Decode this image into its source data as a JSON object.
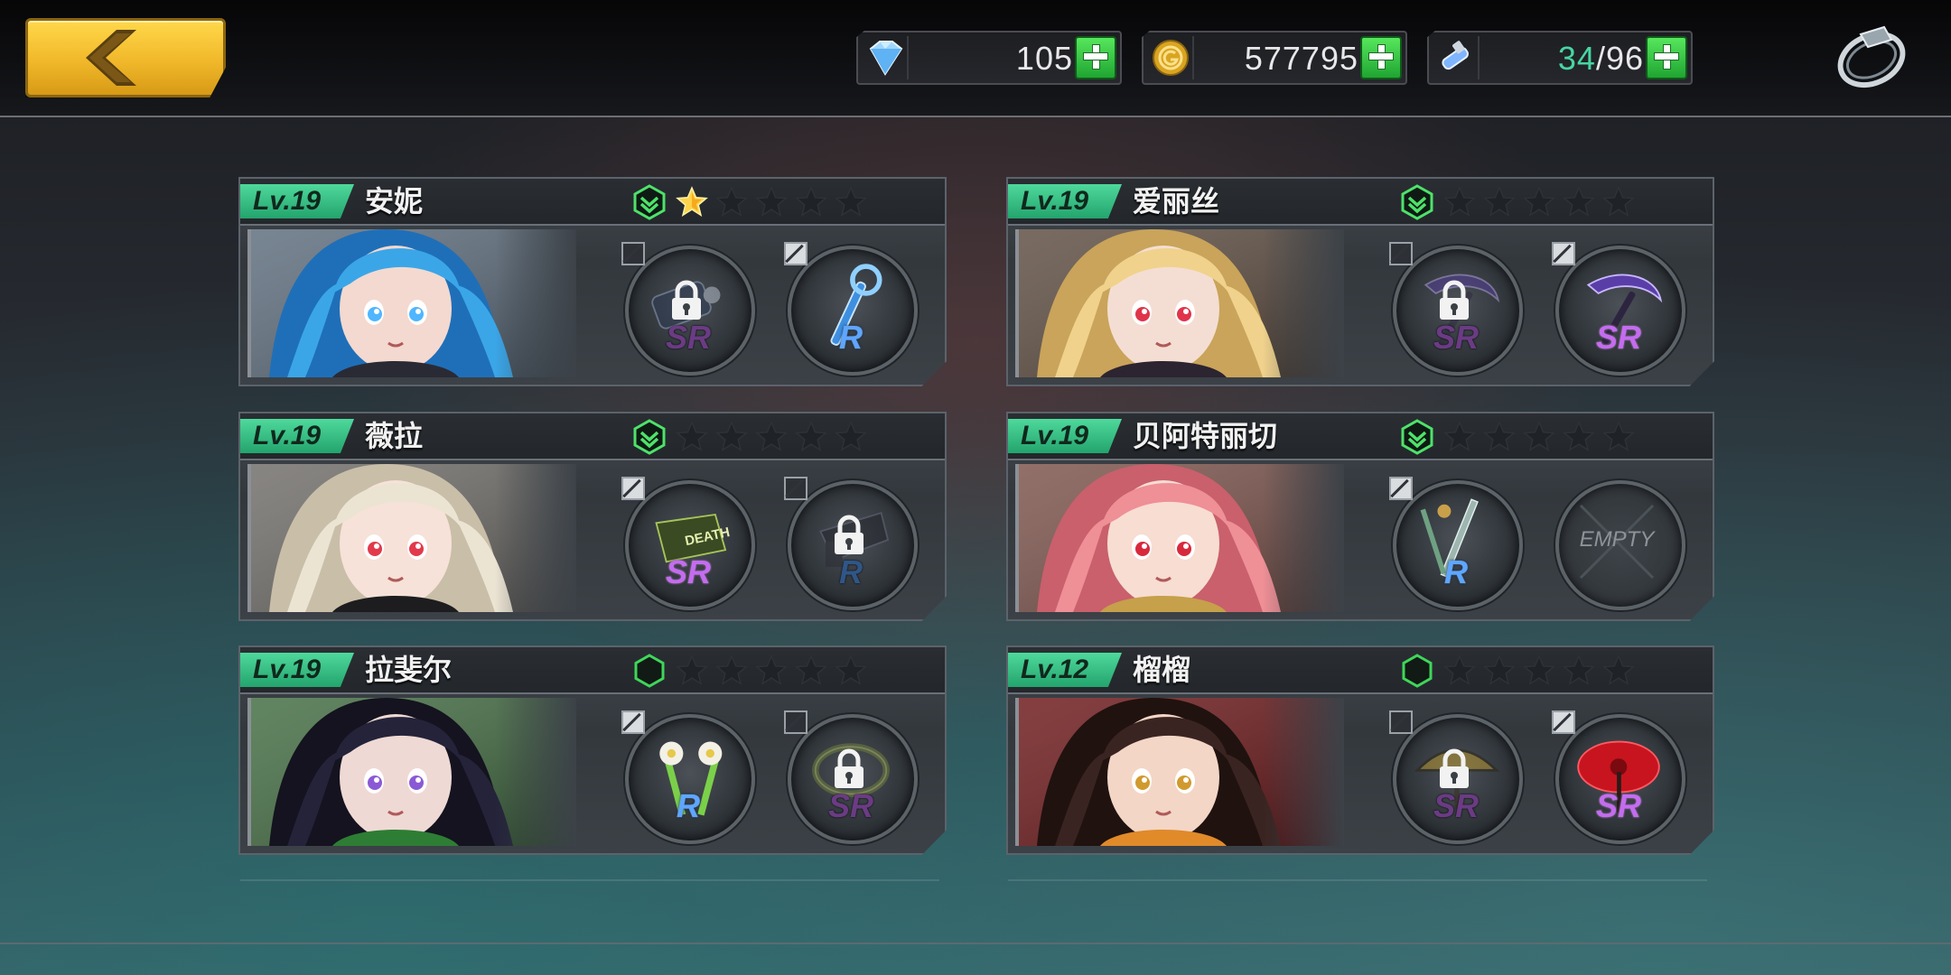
{
  "resources": {
    "gems": "105",
    "gold": "577795",
    "stamina_current": "34",
    "stamina_max": "/96"
  },
  "cards": [
    {
      "level": "Lv.19",
      "name": "安妮",
      "stars_filled": 1,
      "stars_total": 5,
      "badge": "upgrade",
      "weapons": [
        {
          "rarity": "SR",
          "locked": true,
          "art": "cannon"
        },
        {
          "rarity": "R",
          "locked": false,
          "art": "key"
        }
      ]
    },
    {
      "level": "Lv.19",
      "name": "爱丽丝",
      "stars_filled": 0,
      "stars_total": 5,
      "badge": "upgrade",
      "weapons": [
        {
          "rarity": "SR",
          "locked": true,
          "art": "scythe"
        },
        {
          "rarity": "SR",
          "locked": false,
          "art": "scythe"
        }
      ]
    },
    {
      "level": "Lv.19",
      "name": "薇拉",
      "stars_filled": 0,
      "stars_total": 5,
      "badge": "upgrade",
      "weapons": [
        {
          "rarity": "SR",
          "locked": false,
          "art": "coffin",
          "text": "DEATH"
        },
        {
          "rarity": "R",
          "locked": true,
          "art": "gun"
        }
      ]
    },
    {
      "level": "Lv.19",
      "name": "贝阿特丽切",
      "stars_filled": 0,
      "stars_total": 5,
      "badge": "upgrade",
      "weapons": [
        {
          "rarity": "R",
          "locked": false,
          "art": "sword"
        },
        {
          "rarity": "",
          "locked": false,
          "art": "empty",
          "label": "EMPTY"
        }
      ]
    },
    {
      "level": "Lv.19",
      "name": "拉斐尔",
      "stars_filled": 0,
      "stars_total": 5,
      "badge": "hex",
      "weapons": [
        {
          "rarity": "R",
          "locked": false,
          "art": "flowers"
        },
        {
          "rarity": "SR",
          "locked": true,
          "art": "ring"
        }
      ]
    },
    {
      "level": "Lv.12",
      "name": "榴榴",
      "stars_filled": 0,
      "stars_total": 5,
      "badge": "hex",
      "weapons": [
        {
          "rarity": "SR",
          "locked": true,
          "art": "umbrella"
        },
        {
          "rarity": "SR",
          "locked": false,
          "art": "umbrella-red"
        }
      ]
    }
  ],
  "colors": {
    "level_tag": "#2fbf80",
    "sr": "#c46cf0",
    "r": "#5ea6ff",
    "gold_button": "#f0b82a",
    "plus_button": "#2fbf3a"
  }
}
